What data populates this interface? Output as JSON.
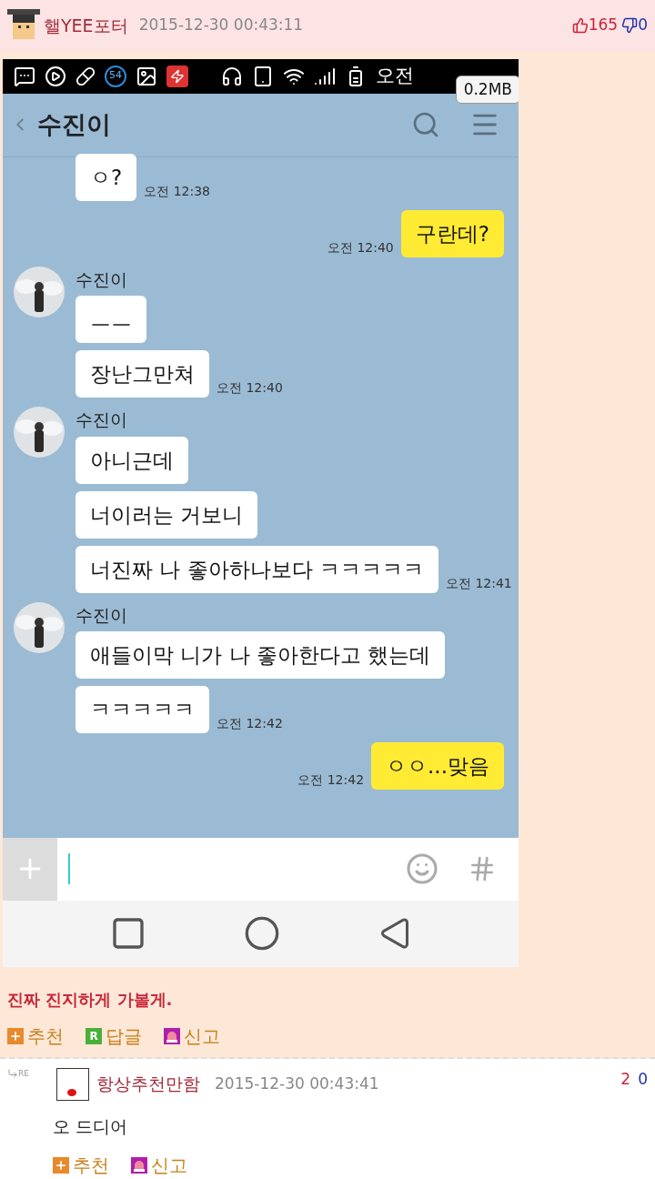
{
  "post": {
    "author": "핼YEE포터",
    "date": "2015-12-30 00:43:11",
    "upvotes": "165",
    "downvotes": "0",
    "screenshot": {
      "status_bar": {
        "notification_count": "54",
        "clock": "오전",
        "size_badge": "0.2MB"
      },
      "chat_title": "수진이",
      "groups": [
        {
          "kind": "received",
          "bubbles": [
            {
              "text": "ㅇ?",
              "time": "오전 12:38"
            }
          ]
        },
        {
          "kind": "sent",
          "bubbles": [
            {
              "text": "구란데?",
              "time": "오전 12:40"
            }
          ]
        },
        {
          "kind": "received",
          "sender": "수진이",
          "bubbles": [
            {
              "text": "ㅡㅡ"
            },
            {
              "text": "장난그만쳐",
              "time": "오전 12:40"
            }
          ]
        },
        {
          "kind": "received",
          "sender": "수진이",
          "bubbles": [
            {
              "text": "아니근데"
            },
            {
              "text": "너이러는 거보니"
            },
            {
              "text": "너진짜 나 좋아하나보다 ㅋㅋㅋㅋㅋ",
              "time": "오전 12:41"
            }
          ]
        },
        {
          "kind": "received",
          "sender": "수진이",
          "bubbles": [
            {
              "text": "애들이막 니가 나 좋아한다고 했는데"
            },
            {
              "text": "ㅋㅋㅋㅋㅋ",
              "time": "오전 12:42"
            }
          ]
        },
        {
          "kind": "sent",
          "bubbles": [
            {
              "text": "ㅇㅇ...맞음",
              "time": "오전 12:42"
            }
          ]
        }
      ]
    },
    "caption": "진짜 진지하게 가볼게.",
    "actions": [
      {
        "kind": "recommend",
        "label": "추천"
      },
      {
        "kind": "reply",
        "badge": "R",
        "label": "답글"
      },
      {
        "kind": "report",
        "label": "신고"
      }
    ]
  },
  "comment": {
    "marker": "RE",
    "author": "항상추천만함",
    "date": "2015-12-30 00:43:41",
    "upvotes": "2",
    "downvotes": "0",
    "text": "오 드디어",
    "actions": [
      {
        "kind": "recommend",
        "label": "추천"
      },
      {
        "kind": "report",
        "label": "신고"
      }
    ]
  }
}
